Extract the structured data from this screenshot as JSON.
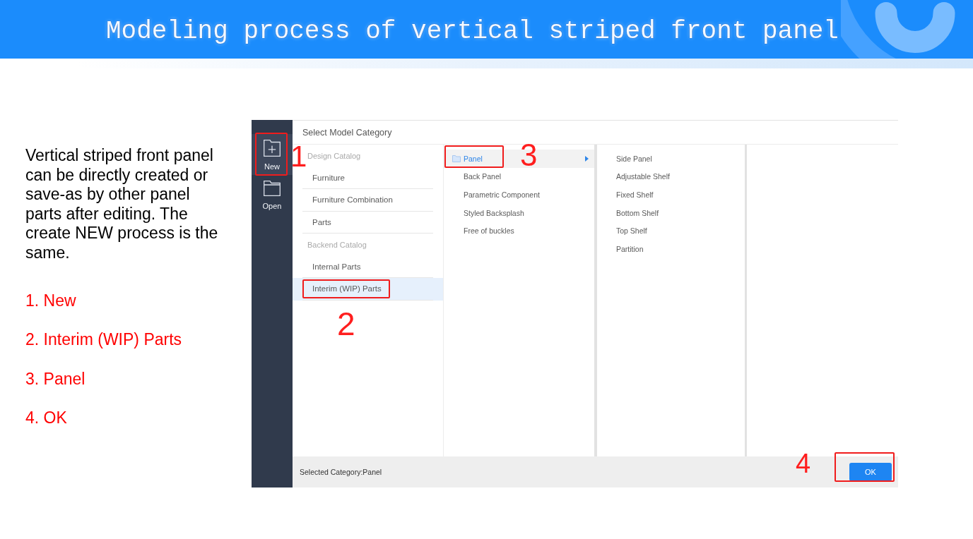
{
  "header": {
    "title": "Modeling process of vertical striped front panel"
  },
  "description": "Vertical striped front panel can be directly created or save-as by other panel parts after editing. The create NEW process is the same.",
  "steps": [
    "1. New",
    "2. Interim (WIP) Parts",
    "3. Panel",
    "4. OK"
  ],
  "app": {
    "sidebar": [
      {
        "kind": "new",
        "label": "New",
        "selected": true,
        "highlighted": true,
        "callout": "1"
      },
      {
        "kind": "open",
        "label": "Open",
        "selected": false,
        "highlighted": false
      }
    ],
    "title": "Select Model Category",
    "catalog": [
      {
        "heading": "Design Catalog",
        "items": [
          {
            "label": "Furniture",
            "selected": false,
            "highlighted": false
          },
          {
            "label": "Furniture Combination",
            "selected": false,
            "highlighted": false
          },
          {
            "label": "Parts",
            "selected": false,
            "highlighted": false
          }
        ]
      },
      {
        "heading": "Backend Catalog",
        "items": [
          {
            "label": "Internal Parts",
            "selected": false,
            "highlighted": false
          },
          {
            "label": "Interim (WIP) Parts",
            "selected": true,
            "highlighted": true,
            "callout": "2"
          }
        ]
      }
    ],
    "categories": [
      {
        "kind": "folder",
        "label": "Panel",
        "selected": true,
        "highlighted": true,
        "callout": "3"
      },
      {
        "kind": "leaf",
        "label": "Back Panel",
        "selected": false,
        "highlighted": false
      },
      {
        "kind": "leaf",
        "label": "Parametric Component",
        "selected": false,
        "highlighted": false
      },
      {
        "kind": "leaf",
        "label": "Styled Backsplash",
        "selected": false,
        "highlighted": false
      },
      {
        "kind": "leaf",
        "label": "Free of buckles",
        "selected": false,
        "highlighted": false
      }
    ],
    "subcategories": [
      {
        "label": "Side Panel",
        "selected": false
      },
      {
        "label": "Adjustable Shelf",
        "selected": false
      },
      {
        "label": "Fixed Shelf",
        "selected": false
      },
      {
        "label": "Bottom Shelf",
        "selected": false
      },
      {
        "label": "Top Shelf",
        "selected": false
      },
      {
        "label": "Partition",
        "selected": false
      }
    ],
    "status": "Selected Category:Panel",
    "ok_button": {
      "label": "OK",
      "highlighted": true,
      "callout": "4"
    }
  }
}
